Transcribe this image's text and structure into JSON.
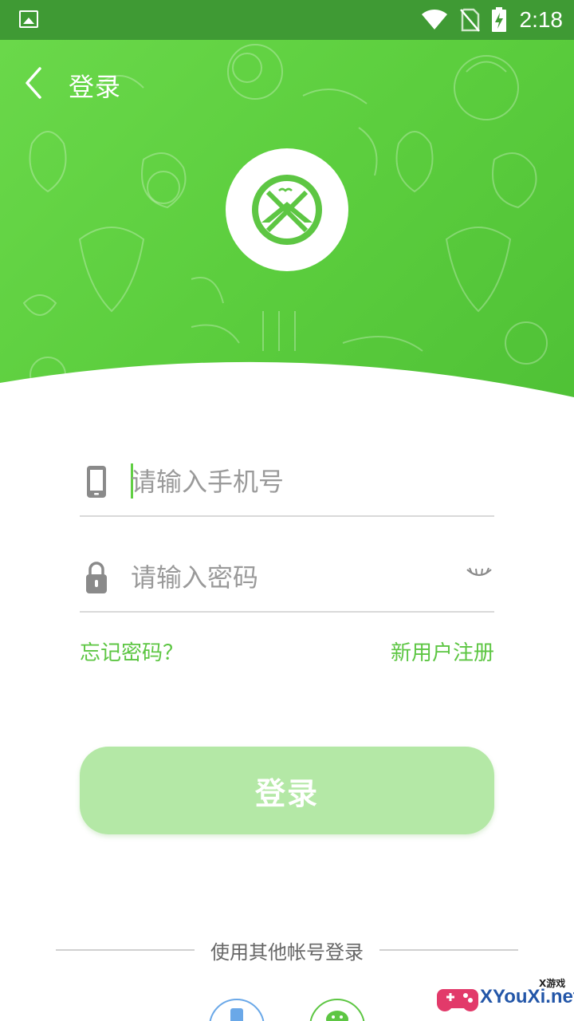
{
  "status_bar": {
    "time": "2:18",
    "icons": [
      "image-icon",
      "wifi-icon",
      "no-sim-icon",
      "battery-charging-icon"
    ]
  },
  "header": {
    "title": "登录",
    "back_icon": "chevron-left-icon",
    "logo": "app-logo-icon",
    "background_color": "#5cce3e"
  },
  "form": {
    "phone": {
      "placeholder": "请输入手机号",
      "value": "",
      "icon": "phone-icon"
    },
    "password": {
      "placeholder": "请输入密码",
      "value": "",
      "icon": "lock-icon",
      "toggle_icon": "eye-closed-icon"
    },
    "forgot_label": "忘记密码？",
    "register_label": "新用户注册",
    "login_label": "登录"
  },
  "other_login": {
    "label": "使用其他帐号登录",
    "providers": [
      "phone-login-icon",
      "wechat-icon"
    ]
  },
  "watermark": {
    "brand": "XYouXi.net",
    "small": "X游戏"
  },
  "colors": {
    "accent": "#5dc643",
    "status_bar": "#3f9a34",
    "login_button": "#b4e8a6"
  }
}
